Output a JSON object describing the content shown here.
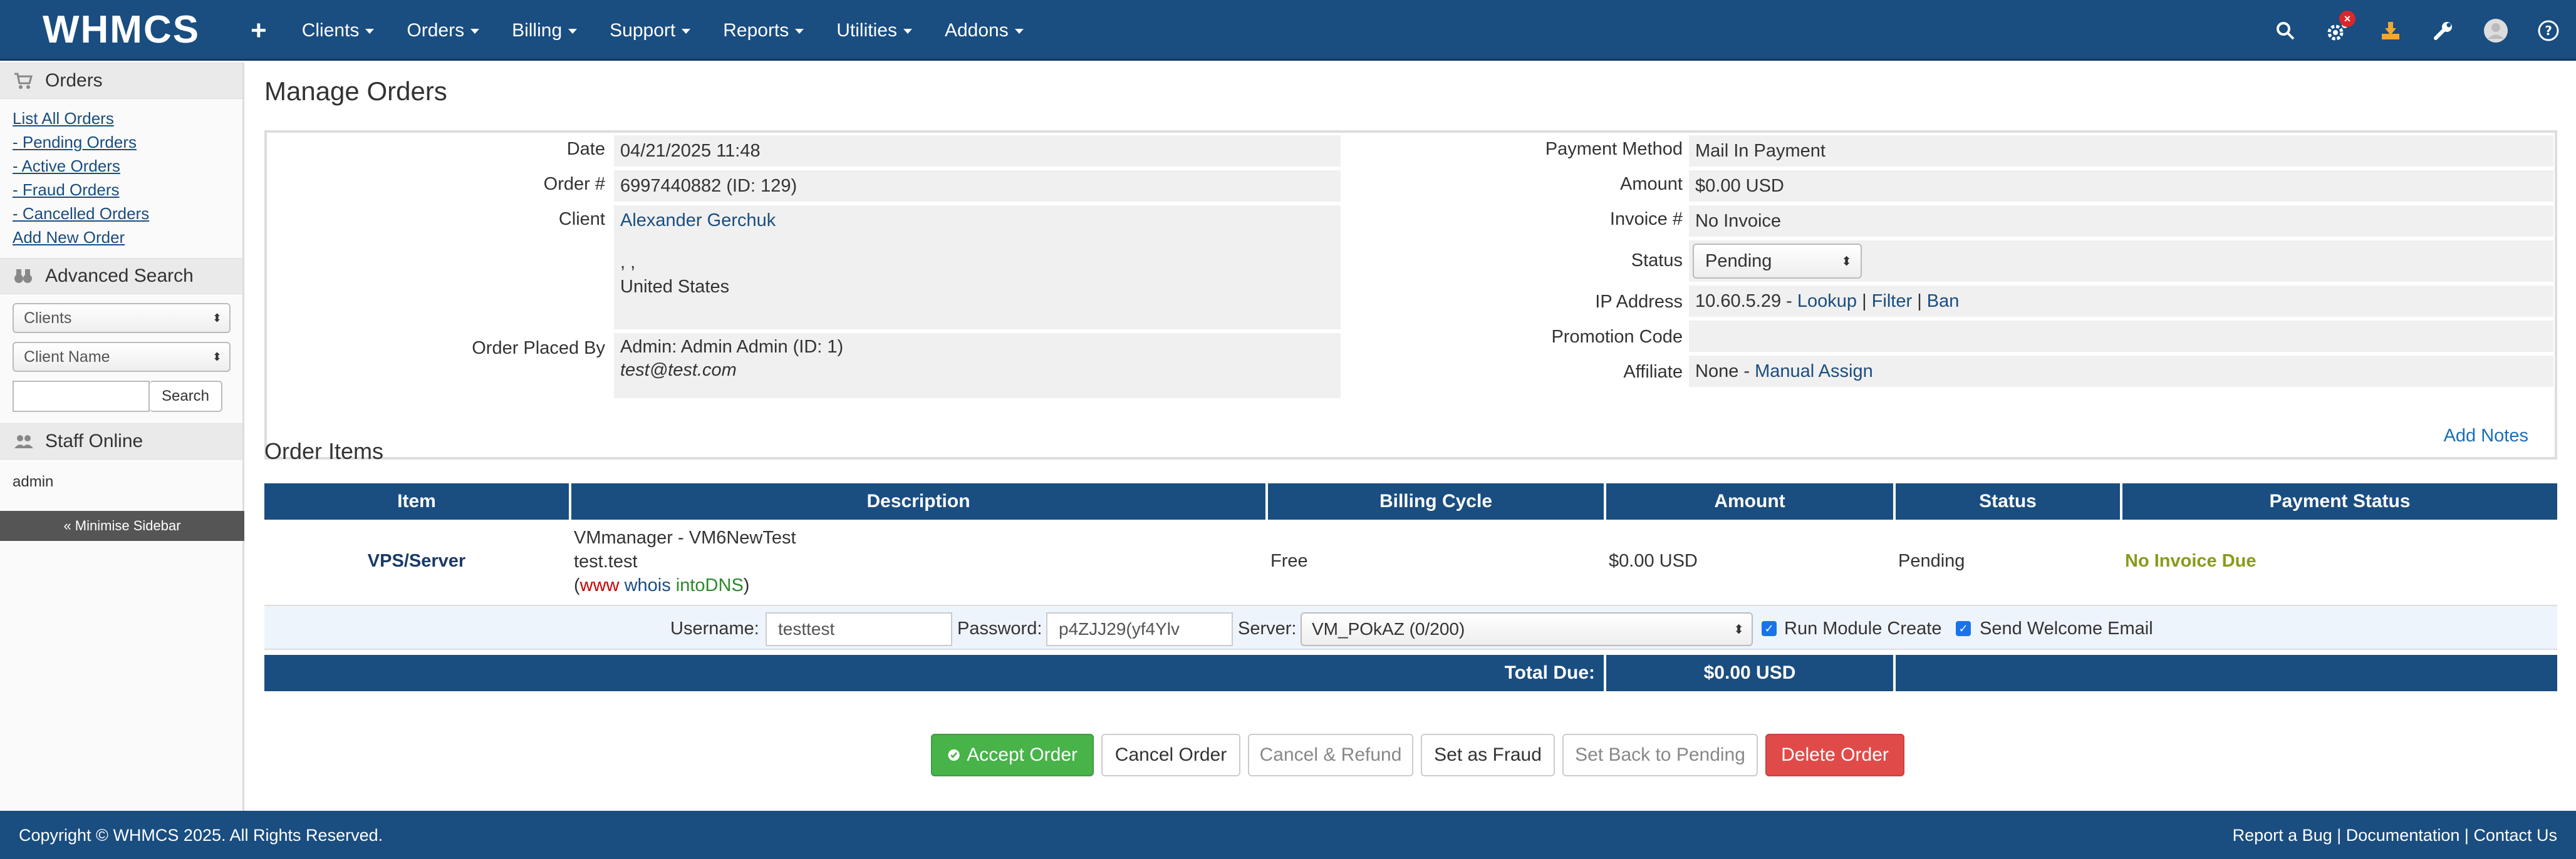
{
  "brand": {
    "logo_text": "WHMCS",
    "color": "#1a4d80"
  },
  "nav": {
    "plus": "+",
    "items": [
      "Clients",
      "Orders",
      "Billing",
      "Support",
      "Reports",
      "Utilities",
      "Addons"
    ],
    "icons": [
      "search-icon",
      "automation-gear-icon",
      "download-icon",
      "wrench-icon",
      "avatar-icon",
      "help-icon"
    ],
    "badge": "×"
  },
  "sidebar": {
    "orders_title": "Orders",
    "links": [
      "List All Orders",
      "- Pending Orders",
      "- Active Orders",
      "- Fraud Orders",
      "- Cancelled Orders",
      "Add New Order"
    ],
    "advanced_search_title": "Advanced Search",
    "search_type": "Clients",
    "search_field": "Client Name",
    "search_button": "Search",
    "staff_online_title": "Staff Online",
    "staff_online_user": "admin",
    "minimise": "« Minimise Sidebar"
  },
  "page": {
    "title": "Manage Orders"
  },
  "summary": {
    "date_label": "Date",
    "date_value": "04/21/2025 11:48",
    "order_label": "Order #",
    "order_value": "6997440882 (ID: 129)",
    "client_label": "Client",
    "client_name": "Alexander Gerchuk",
    "client_addr1": ", ,",
    "client_country": "United States",
    "placed_by_label": "Order Placed By",
    "placed_by_value": "Admin: Admin Admin (ID: 1)",
    "placed_by_email": "test@test.com",
    "payment_method_label": "Payment Method",
    "payment_method_value": "Mail In Payment",
    "amount_label": "Amount",
    "amount_value": "$0.00 USD",
    "invoice_label": "Invoice #",
    "invoice_value": "No Invoice",
    "status_label": "Status",
    "status_value": "Pending",
    "ip_label": "IP Address",
    "ip_value": "10.60.5.29 - ",
    "ip_lookup": "Lookup",
    "ip_filter": "Filter",
    "ip_ban": "Ban",
    "ip_sep": "|",
    "promo_label": "Promotion Code",
    "promo_value": "",
    "affiliate_label": "Affiliate",
    "affiliate_value": "None - ",
    "affiliate_link": "Manual Assign"
  },
  "order_items": {
    "title": "Order Items",
    "add_notes": "Add Notes",
    "headers": [
      "Item",
      "Description",
      "Billing Cycle",
      "Amount",
      "Status",
      "Payment Status"
    ],
    "row": {
      "item": "VPS/Server",
      "desc_line1": "VMmanager - VM6NewTest",
      "desc_line2": "test.test",
      "desc_open": "(",
      "www": "www",
      "whois": "whois",
      "intodns": "intoDNS",
      "desc_close": ")",
      "billing_cycle": "Free",
      "amount": "$0.00 USD",
      "status": "Pending",
      "payment_status": "No Invoice Due"
    },
    "module": {
      "username_label": "Username:",
      "username_value": "testtest",
      "password_label": "Password:",
      "password_value": "p4ZJJ29(yf4Ylv",
      "server_label": "Server:",
      "server_value": "VM_POkAZ (0/200)",
      "run_module_create": "Run Module Create",
      "send_welcome_email": "Send Welcome Email"
    },
    "total_label": "Total Due:",
    "total_value": "$0.00 USD"
  },
  "actions": {
    "accept": "Accept Order",
    "cancel": "Cancel Order",
    "cancel_refund": "Cancel & Refund",
    "fraud": "Set as Fraud",
    "back_pending": "Set Back to Pending",
    "delete": "Delete Order"
  },
  "footer": {
    "copyright": "Copyright © WHMCS 2025. All Rights Reserved.",
    "report_bug": "Report a Bug",
    "documentation": "Documentation",
    "contact": "Contact Us",
    "sep": "|"
  }
}
